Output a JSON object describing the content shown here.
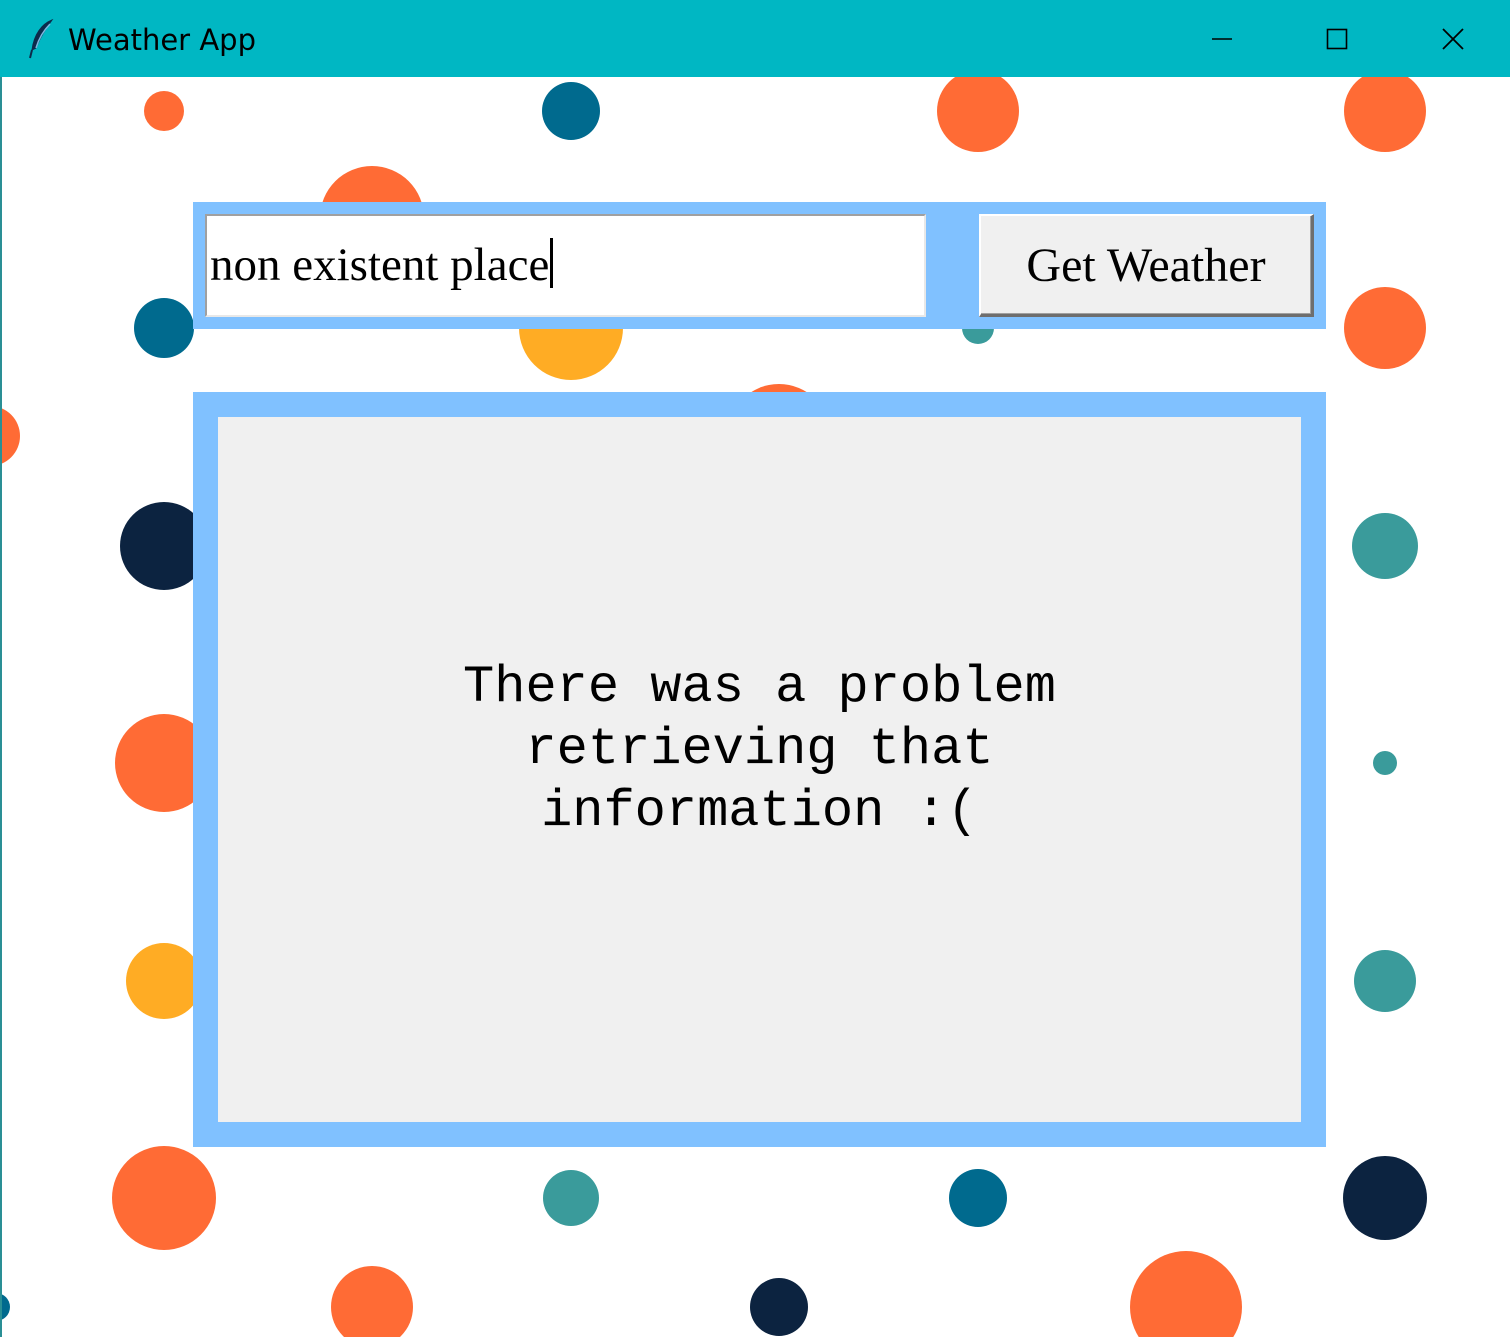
{
  "window": {
    "title": "Weather App",
    "titlebar_color": "#00b7c3",
    "icons": {
      "app": "feather-icon",
      "minimize": "minimize-icon",
      "maximize": "maximize-icon",
      "close": "close-icon"
    }
  },
  "search": {
    "value": "non existent place",
    "button_label": "Get Weather",
    "frame_color": "#80c1ff"
  },
  "result": {
    "message": "There was a problem\nretrieving that\ninformation :(",
    "frame_color": "#80c1ff",
    "panel_color": "#f0f0f0"
  },
  "background": {
    "pattern": "polka dots",
    "dot_colors": [
      "#ff6b35",
      "#006a8e",
      "#ffac24",
      "#3a9b9b",
      "#0c2340"
    ]
  }
}
